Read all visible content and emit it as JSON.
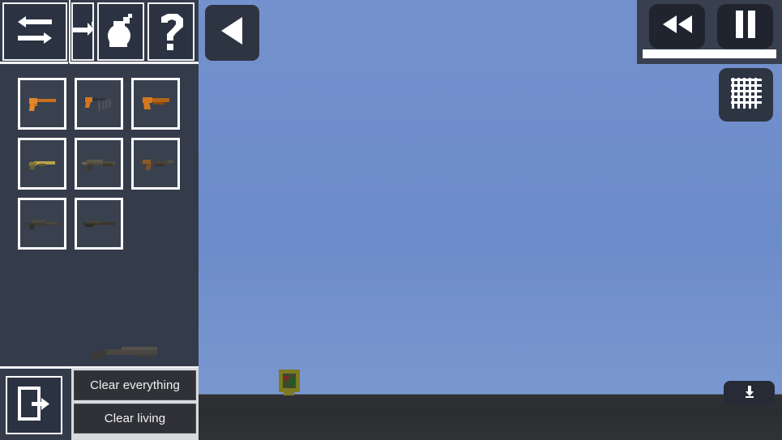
{
  "app": {
    "title": "Weapon Sandbox Editor"
  },
  "toolbar": {
    "buttons": [
      {
        "name": "swap-tool",
        "icon": "swap-arrows-icon",
        "label": "Swap"
      },
      {
        "name": "next-tool",
        "icon": "arrow-right-icon",
        "label": "Next"
      },
      {
        "name": "bomb-tool",
        "icon": "grenade-icon",
        "label": "Grenade"
      },
      {
        "name": "help-tool",
        "icon": "question-mark-icon",
        "label": "Help"
      }
    ]
  },
  "weapons": {
    "slots": [
      {
        "id": 1,
        "icon": "pistol-icon",
        "label": "Pistol"
      },
      {
        "id": 2,
        "icon": "smg-icon",
        "label": "SMG"
      },
      {
        "id": 3,
        "icon": "sawed-off-icon",
        "label": "Sawed-off Shotgun"
      },
      {
        "id": 4,
        "icon": "carbine-icon",
        "label": "Carbine"
      },
      {
        "id": 5,
        "icon": "assault-rifle-icon",
        "label": "Assault Rifle"
      },
      {
        "id": 6,
        "icon": "ak-rifle-icon",
        "label": "AK Rifle"
      },
      {
        "id": 7,
        "icon": "sniper-icon",
        "label": "Sniper Rifle"
      },
      {
        "id": 8,
        "icon": "marksman-icon",
        "label": "Marksman Rifle"
      }
    ],
    "preview_icon": "shotgun-preview-icon"
  },
  "sidebar_bottom": {
    "exit_icon": "exit-door-icon",
    "exit_label": "Exit"
  },
  "clear_panel": {
    "clear_everything_label": "Clear everything",
    "clear_living_label": "Clear living"
  },
  "overlay_controls": {
    "back_icon": "play-left-triangle-icon",
    "back_label": "Back",
    "rewind_icon": "rewind-double-triangle-icon",
    "rewind_label": "Rewind",
    "pause_icon": "pause-bars-icon",
    "pause_label": "Pause",
    "timeline_value": "",
    "grid_icon": "grid-mesh-icon",
    "grid_label": "Toggle grid",
    "download_icon": "download-arrow-icon",
    "download_label": "Download"
  },
  "scene": {
    "player_label": "pixel-character",
    "sky_color": "#6e8fcb",
    "ground_color": "#2e3034"
  },
  "colors": {
    "sidebar_bg": "#343b4a",
    "panel_bg": "#38404f",
    "button_dark": "#2b3342",
    "outline_white": "#ffffff",
    "clear_panel_bg": "#d9dade",
    "clear_button_bg": "#2f3136",
    "weapon_accent": "#c8701e"
  }
}
